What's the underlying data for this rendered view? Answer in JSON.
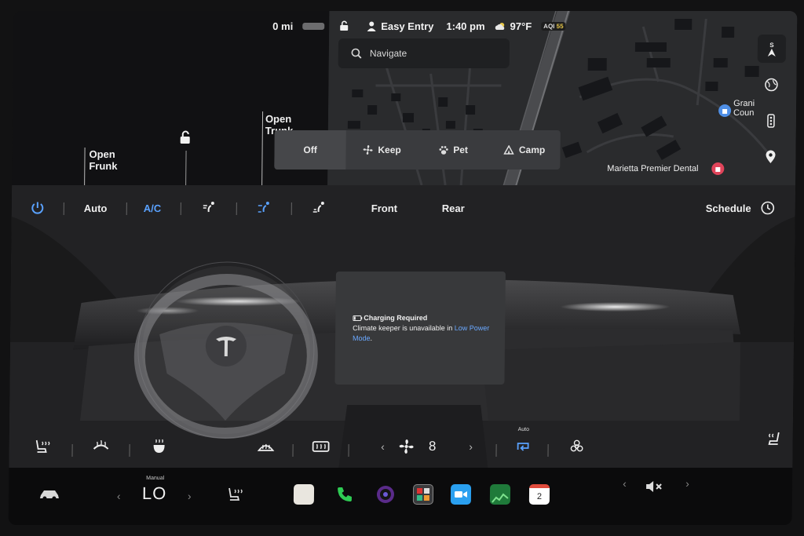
{
  "status_bar": {
    "range": "0 mi",
    "profile": "Easy Entry",
    "time": "1:40 pm",
    "temperature": "97°F",
    "aqi_label": "AQI",
    "aqi_value": "55"
  },
  "car": {
    "frunk_label": "Open\nFrunk",
    "trunk_label": "Open\nTrunk"
  },
  "map": {
    "search_placeholder": "Navigate",
    "compass": "S",
    "poi_1": "Marietta Premier Dental",
    "poi_2": "Grani\nCoun"
  },
  "keep_modes": {
    "options": [
      "Off",
      "Keep",
      "Pet",
      "Camp"
    ],
    "selected": "Off"
  },
  "climate": {
    "auto_label": "Auto",
    "ac_label": "A/C",
    "front_label": "Front",
    "rear_label": "Rear",
    "schedule_label": "Schedule",
    "fan_speed": "8",
    "recirc_auto_label": "Auto",
    "message_title": "Charging Required",
    "message_body": "Climate keeper is unavailable in ",
    "message_link": "Low Power Mode",
    "message_end": "."
  },
  "dock": {
    "temp_mode": "Manual",
    "temp_value": "LO",
    "calendar_day": "2"
  },
  "colors": {
    "accent_blue": "#5aa2ff",
    "phone_green": "#2ecc54",
    "aqi_yellow": "#e8c84a",
    "poi_red": "#e0445a"
  }
}
